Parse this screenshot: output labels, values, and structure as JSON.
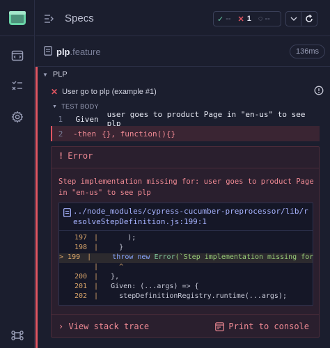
{
  "header": {
    "title": "Specs",
    "stats": {
      "passed": "--",
      "failed": "1",
      "pending": "--"
    }
  },
  "file": {
    "name": "plp",
    "ext": ".feature",
    "duration": "136ms"
  },
  "suite": {
    "title": "PLP"
  },
  "test": {
    "title": "User go to plp (example #1)",
    "body_label": "TEST BODY"
  },
  "steps": [
    {
      "num": "1",
      "keyword": "Given",
      "text": "user goes to product Page in \"en-us\" to see plp"
    },
    {
      "num": "2",
      "keyword": "-then",
      "text": "{}, function(){}"
    }
  ],
  "error": {
    "title": "Error",
    "message": "Step implementation missing for: user goes to product Page in \"en-us\" to see plp",
    "file_path": "../node_modules/cypress-cucumber-preprocessor/lib/resolveStepDefinition.js:199:1",
    "code": [
      {
        "ln": "197",
        "code": "      );"
      },
      {
        "ln": "198",
        "code": "    }"
      },
      {
        "ln": "199",
        "kw": "throw new",
        "cls": "Error",
        "str": "(`Step implementation missing for"
      },
      {
        "ln": "",
        "code": "    ^"
      },
      {
        "ln": "200",
        "code": "  },"
      },
      {
        "ln": "201",
        "code": "  Given: (...args) => {"
      },
      {
        "ln": "202",
        "code": "    stepDefinitionRegistry.runtime(...args);"
      }
    ],
    "view_stack": "View stack trace",
    "print_console": "Print to console"
  },
  "colors": {
    "failed": "#e05561",
    "link": "#a7b3ff"
  }
}
